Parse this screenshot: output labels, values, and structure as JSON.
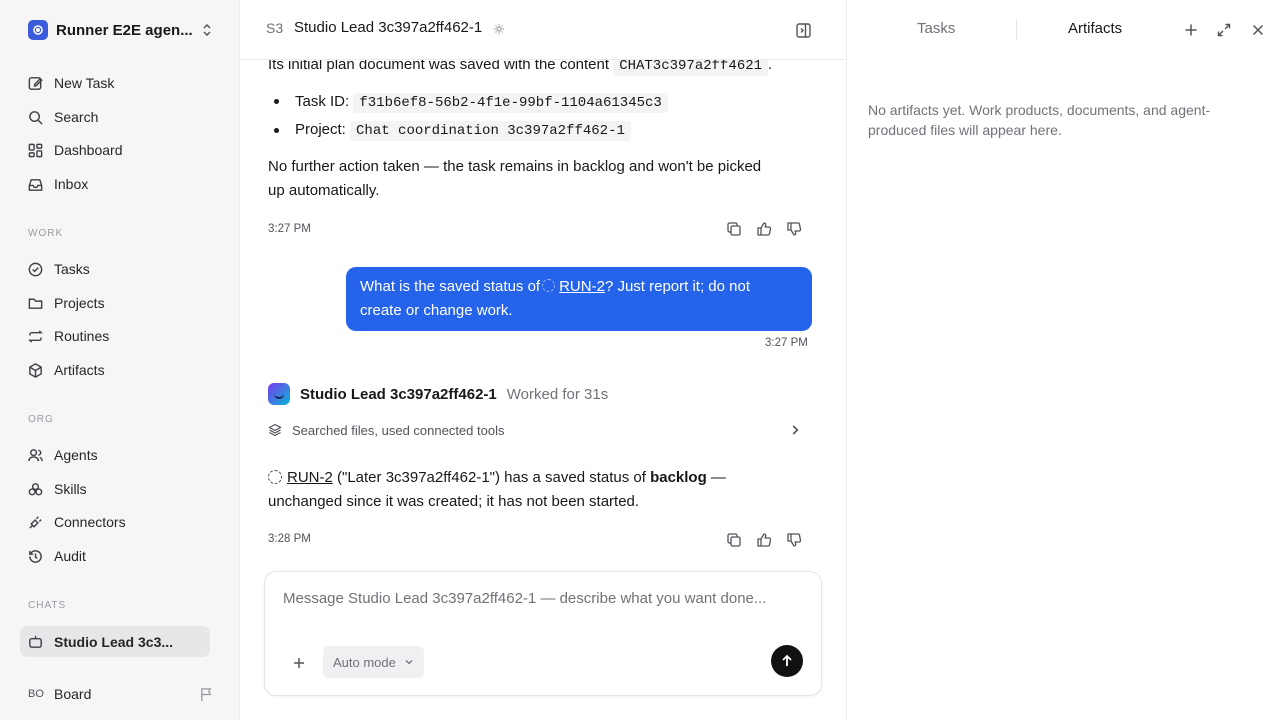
{
  "sidebar": {
    "workspace_name": "Runner E2E agen...",
    "top_items": [
      {
        "label": "New Task",
        "icon": "edit-icon"
      },
      {
        "label": "Search",
        "icon": "search-icon"
      },
      {
        "label": "Dashboard",
        "icon": "dashboard-icon"
      },
      {
        "label": "Inbox",
        "icon": "inbox-icon"
      }
    ],
    "work_label": "WORK",
    "work_items": [
      {
        "label": "Tasks",
        "icon": "check-circle-icon"
      },
      {
        "label": "Projects",
        "icon": "folder-icon"
      },
      {
        "label": "Routines",
        "icon": "repeat-icon"
      },
      {
        "label": "Artifacts",
        "icon": "box-icon"
      }
    ],
    "org_label": "ORG",
    "org_items": [
      {
        "label": "Agents",
        "icon": "users-icon"
      },
      {
        "label": "Skills",
        "icon": "skills-icon"
      },
      {
        "label": "Connectors",
        "icon": "plug-icon"
      },
      {
        "label": "Audit",
        "icon": "history-icon"
      }
    ],
    "chats_label": "CHATS",
    "chat_items": [
      {
        "label": "Studio Lead 3c3...",
        "icon": "bot-icon",
        "active": true
      }
    ],
    "footer": {
      "badge": "BO",
      "label": "Board"
    }
  },
  "header": {
    "badge": "S3",
    "title": "Studio Lead 3c397a2ff462-1"
  },
  "messages": {
    "first": {
      "intro": "Its initial plan document was saved with the content",
      "intro_code": "CHAT3c397a2ff4621",
      "intro_end": ".",
      "task_id_label": "Task ID:",
      "task_id": "f31b6ef8-56b2-4f1e-99bf-1104a61345c3",
      "project_label": "Project:",
      "project": "Chat coordination 3c397a2ff462-1",
      "line1": "No further action taken — the task remains in backlog and won't be picked",
      "line2": "up automatically.",
      "time": "3:27 PM"
    },
    "user": {
      "part1": "What is the saved status of",
      "link": "RUN-2",
      "part2": "? Just report it; do not",
      "line2": "create or change work.",
      "time": "3:27 PM"
    },
    "agent": {
      "name": "Studio Lead 3c397a2ff462-1",
      "worked": "Worked for 31s",
      "tools_summary": "Searched files, used connected tools",
      "link": "RUN-2",
      "text1": " (\"Later 3c397a2ff462-1\") has a saved status of ",
      "bold": "backlog",
      "text2": " —",
      "line2": "unchanged since it was created; it has not been started.",
      "time": "3:28 PM"
    }
  },
  "composer": {
    "placeholder": "Message Studio Lead 3c397a2ff462-1 — describe what you want done...",
    "mode": "Auto mode"
  },
  "right_panel": {
    "tabs": [
      "Tasks",
      "Artifacts"
    ],
    "active_tab": "Artifacts",
    "empty_line1": "No artifacts yet. Work products, documents, and agent-",
    "empty_line2": "produced files will appear here."
  },
  "colors": {
    "accent": "#2563eb",
    "sidebar_bg": "#f6f6f7",
    "send_button": "#111111"
  }
}
